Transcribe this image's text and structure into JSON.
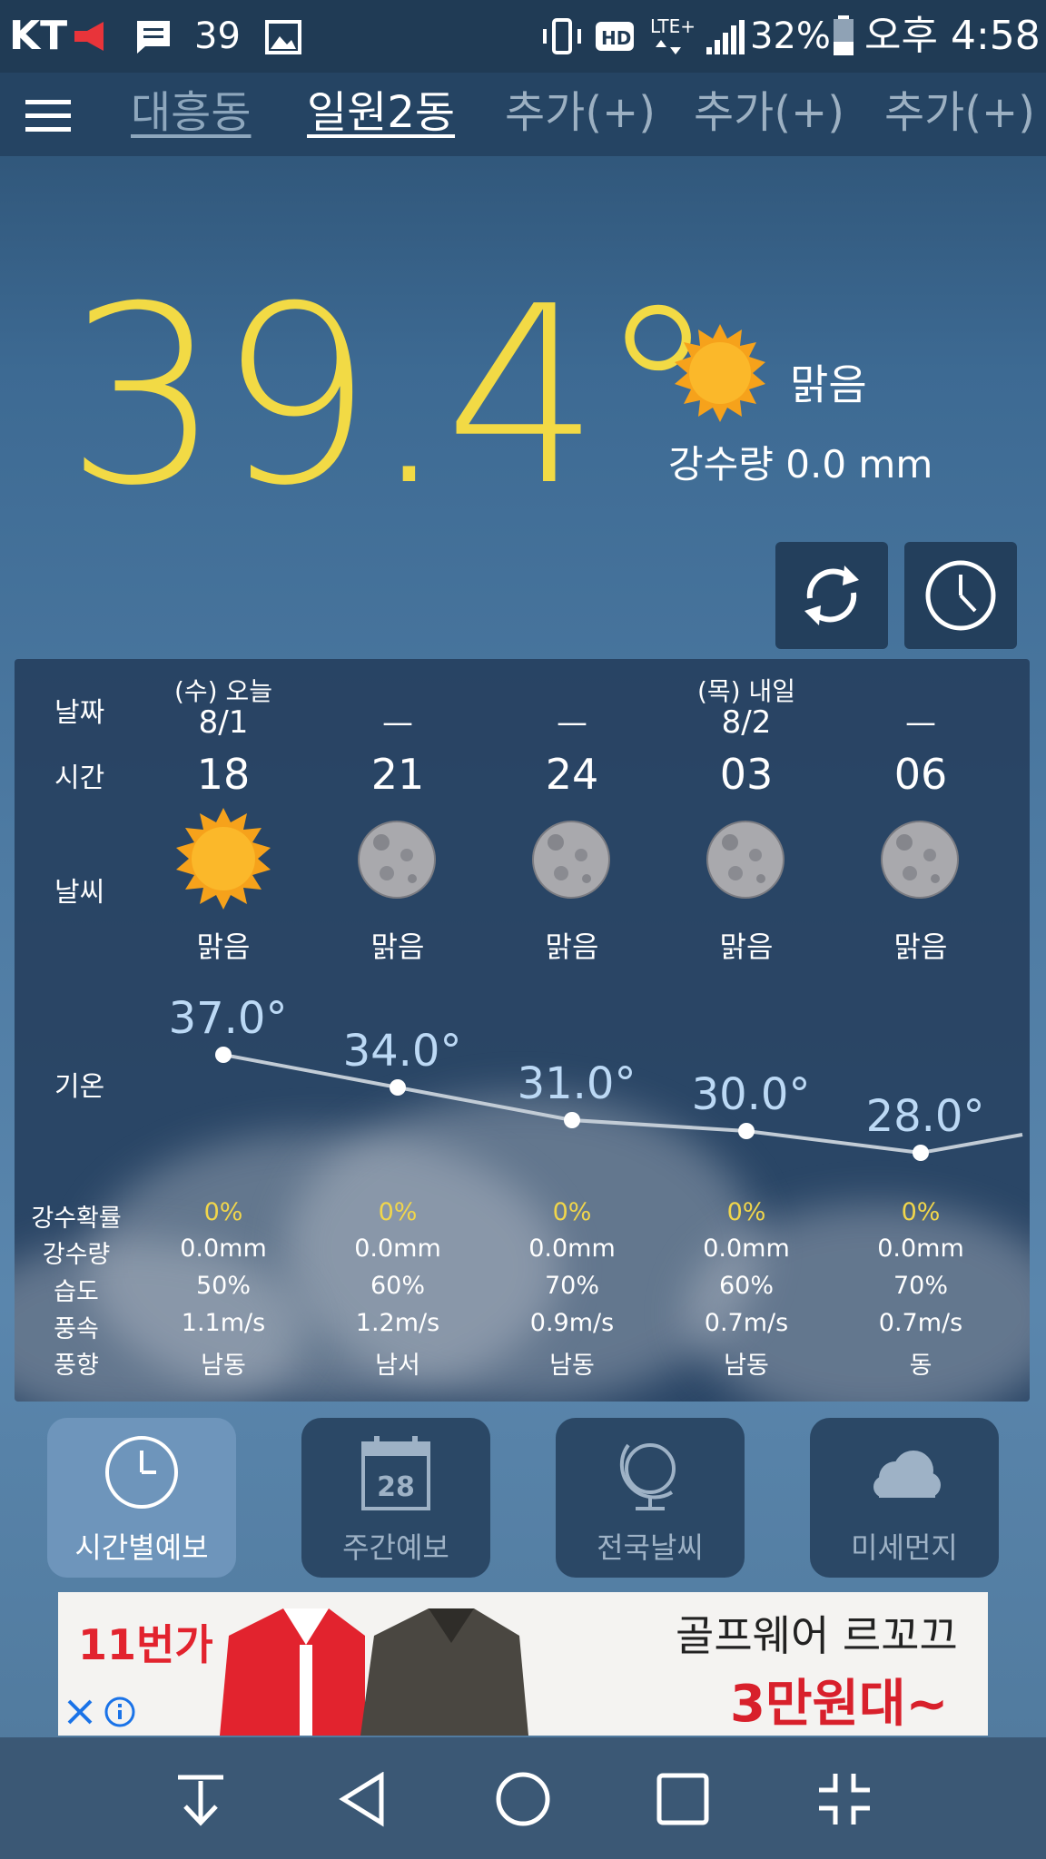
{
  "status_bar": {
    "carrier": "KT",
    "notif_temp": "39",
    "battery": "32%",
    "time": "오후 4:58"
  },
  "tabs": [
    {
      "label": "대흥동"
    },
    {
      "label": "일원2동"
    },
    {
      "label": "추가(+)"
    },
    {
      "label": "추가(+)"
    },
    {
      "label": "추가(+)"
    }
  ],
  "current": {
    "temperature": "39.4°",
    "condition": "맑음",
    "precipitation": "강수량 0.0 mm"
  },
  "hourly": {
    "labels": {
      "date": "날짜",
      "time": "시간",
      "weather": "날씨",
      "temp": "기온",
      "pop": "강수확률",
      "rain": "강수량",
      "humidity": "습도",
      "wind_speed": "풍속",
      "wind_dir": "풍향"
    },
    "day_labels": [
      "(수) 오늘",
      "",
      "",
      "(목) 내일",
      ""
    ],
    "dates": [
      "8/1",
      "—",
      "—",
      "8/2",
      "—"
    ],
    "times": [
      "18",
      "21",
      "24",
      "03",
      "06"
    ],
    "icons": [
      "sun-icon",
      "moon-icon",
      "moon-icon",
      "moon-icon",
      "moon-icon"
    ],
    "conditions": [
      "맑음",
      "맑음",
      "맑음",
      "맑음",
      "맑음"
    ],
    "temps": [
      "37.0°",
      "34.0°",
      "31.0°",
      "30.0°",
      "28.0°"
    ],
    "temp_values": [
      37.0,
      34.0,
      31.0,
      30.0,
      28.0
    ],
    "pop": [
      "0%",
      "0%",
      "0%",
      "0%",
      "0%"
    ],
    "rain": [
      "0.0mm",
      "0.0mm",
      "0.0mm",
      "0.0mm",
      "0.0mm"
    ],
    "humidity": [
      "50%",
      "60%",
      "70%",
      "60%",
      "70%"
    ],
    "wind_speed": [
      "1.1m/s",
      "1.2m/s",
      "0.9m/s",
      "0.7m/s",
      "0.7m/s"
    ],
    "wind_dir": [
      "남동",
      "남서",
      "남동",
      "남동",
      "동"
    ]
  },
  "bottom_nav": [
    {
      "label": "시간별예보",
      "icon": "clock-icon"
    },
    {
      "label": "주간예보",
      "icon": "calendar-icon"
    },
    {
      "label": "전국날씨",
      "icon": "globe-icon"
    },
    {
      "label": "미세먼지",
      "icon": "cloud-icon"
    }
  ],
  "calendar_day": "28",
  "ad": {
    "brand": "11번가",
    "headline": "골프웨어 르꼬끄",
    "price": "3만원대~"
  },
  "colors": {
    "temp_yellow": "#f2da45",
    "pop_yellow": "#f1d64b",
    "temp_blue": "#bcd9f5"
  }
}
